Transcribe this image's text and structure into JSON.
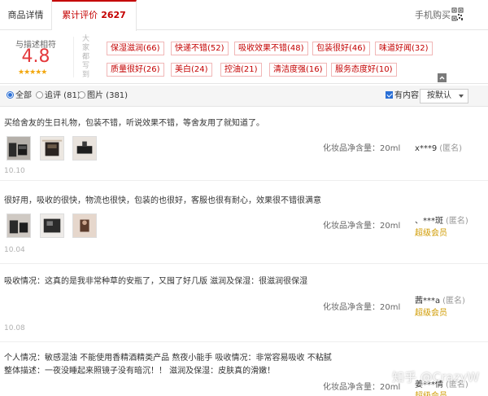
{
  "tabs": {
    "detail_label": "商品详情",
    "review_label": "累计评价",
    "review_count": "2627"
  },
  "mobile_buy_label": "手机购买",
  "summary": {
    "score_label": "与描述相符",
    "score": "4.8",
    "stars": "★★★★★",
    "vertical_label": "大家都写到",
    "tags": [
      "保湿滋润(66)",
      "快递不错(52)",
      "吸收效果不错(48)",
      "包装很好(46)",
      "味道好闻(32)",
      "质量很好(26)",
      "美白(24)",
      "控油(21)",
      "清洁度强(16)",
      "服务态度好(10)"
    ]
  },
  "filter": {
    "all_label": "全部",
    "followup_label": "追评 (81)",
    "photo_label": "图片 (381)",
    "has_content_label": "有内容",
    "sort_label": "按默认"
  },
  "reviews": [
    {
      "text": [
        "买给舍友的生日礼物，包装不错，听说效果不错，等舍友用了就知道了。"
      ],
      "date": "10.10",
      "spec": "化妆品净含量：20ml",
      "user": "x***9",
      "anon": "(匿名)",
      "vip": ""
    },
    {
      "text": [
        "很好用，吸收的很快，物流也很快，包装的也很好，客服也很有耐心，效果很不错很满意"
      ],
      "date": "10.04",
      "spec": "化妆品净含量：20ml",
      "user": "、***斑",
      "anon": "(匿名)",
      "vip": "超级会员"
    },
    {
      "text": [
        "吸收情况：这真的是我非常种草的安瓶了，又囤了好几版 滋润及保湿：很滋润很保湿"
      ],
      "date": "10.08",
      "spec": "化妆品净含量：20ml",
      "user": "茜***a",
      "anon": "(匿名)",
      "vip": "超级会员"
    },
    {
      "text": [
        "个人情况：敏感混油 不能使用香精酒精类产品 熬夜小能手 吸收情况：非常容易吸收 不粘腻",
        "整体描述：一夜没睡起来照镜子没有暗沉！！ 滋润及保湿：皮肤真的滑嫩！"
      ],
      "date": "",
      "spec": "化妆品净含量：20ml",
      "user": "姜***倩",
      "anon": "(匿名)",
      "vip": "超级会员"
    }
  ],
  "watermark": "知乎 @CrazyW"
}
